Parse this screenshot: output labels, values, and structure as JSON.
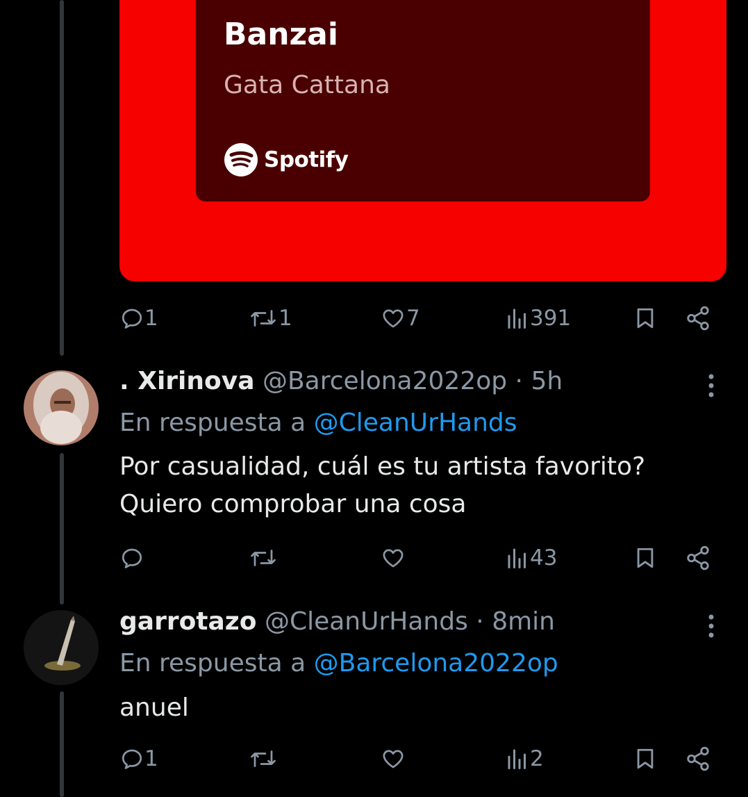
{
  "card": {
    "title": "Banzai",
    "artist": "Gata Cattana",
    "brand": "Spotify",
    "colors": {
      "outer": "#f70000",
      "inner": "#4a0000"
    }
  },
  "tweets": [
    {
      "actions": {
        "replies": "1",
        "reposts": "1",
        "likes": "7",
        "views": "391"
      }
    },
    {
      "name": ". Xirinova",
      "handle": "@Barcelona2022op",
      "dot": "·",
      "time": "5h",
      "reply_prefix": "En respuesta a",
      "reply_to": "@CleanUrHands",
      "text_lines": [
        "Por casualidad, cuál es tu artista favorito?",
        "Quiero comprobar una cosa"
      ],
      "actions": {
        "replies": "",
        "reposts": "",
        "likes": "",
        "views": "43"
      }
    },
    {
      "name": "garrotazo",
      "handle": "@CleanUrHands",
      "dot": "·",
      "time": "8min",
      "reply_prefix": "En respuesta a",
      "reply_to": "@Barcelona2022op",
      "text_lines": [
        "anuel"
      ],
      "actions": {
        "replies": "1",
        "reposts": "",
        "likes": "",
        "views": "2"
      }
    }
  ],
  "icons": [
    "reply-icon",
    "repost-icon",
    "like-icon",
    "views-icon",
    "bookmark-icon",
    "share-icon",
    "more-icon",
    "spotify-icon"
  ],
  "colors": {
    "background": "#000000",
    "muted": "#8b98a5",
    "link": "#1d9bf0",
    "text": "#e7e9ea"
  }
}
